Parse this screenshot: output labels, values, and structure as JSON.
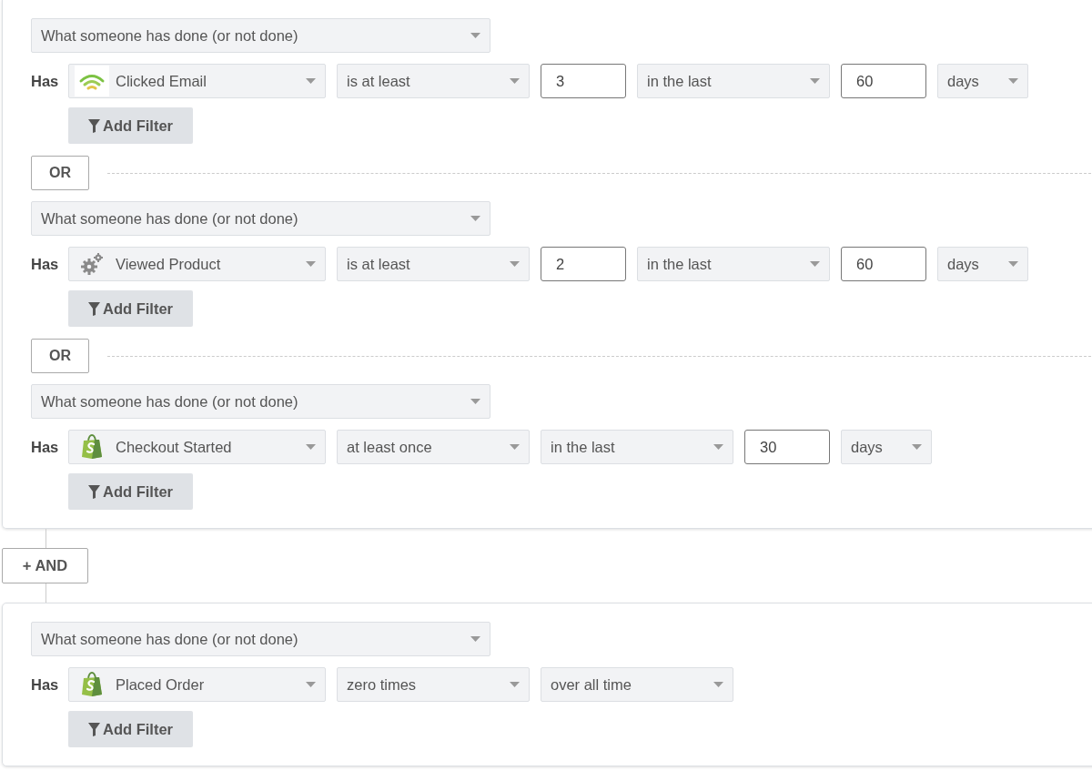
{
  "groups": [
    {
      "conditions": [
        {
          "type_label": "What someone has done (or not done)",
          "has_label": "Has",
          "metric": {
            "label": "Clicked Email",
            "kind": "email"
          },
          "fields": [
            {
              "kind": "select",
              "value": "is at least"
            },
            {
              "kind": "input",
              "value": "3"
            },
            {
              "kind": "select",
              "value": "in the last"
            },
            {
              "kind": "input",
              "value": "60"
            },
            {
              "kind": "unit",
              "value": "days"
            }
          ],
          "add_filter": "Add Filter",
          "join": "OR"
        },
        {
          "type_label": "What someone has done (or not done)",
          "has_label": "Has",
          "metric": {
            "label": "Viewed Product",
            "kind": "gear"
          },
          "fields": [
            {
              "kind": "select",
              "value": "is at least"
            },
            {
              "kind": "input",
              "value": "2"
            },
            {
              "kind": "select",
              "value": "in the last"
            },
            {
              "kind": "input",
              "value": "60"
            },
            {
              "kind": "unit",
              "value": "days"
            }
          ],
          "add_filter": "Add Filter",
          "join": "OR"
        },
        {
          "type_label": "What someone has done (or not done)",
          "has_label": "Has",
          "metric": {
            "label": "Checkout Started",
            "kind": "bag"
          },
          "fields": [
            {
              "kind": "select",
              "value": "at least once"
            },
            {
              "kind": "select",
              "value": "in the last"
            },
            {
              "kind": "input",
              "value": "30"
            },
            {
              "kind": "unit",
              "value": "days"
            }
          ],
          "add_filter": "Add Filter"
        }
      ],
      "and_label": "+ AND"
    },
    {
      "conditions": [
        {
          "type_label": "What someone has done (or not done)",
          "has_label": "Has",
          "metric": {
            "label": "Placed Order",
            "kind": "bag"
          },
          "fields": [
            {
              "kind": "select",
              "value": "zero times"
            },
            {
              "kind": "select",
              "value": "over all time"
            }
          ],
          "add_filter": "Add Filter"
        }
      ]
    }
  ]
}
